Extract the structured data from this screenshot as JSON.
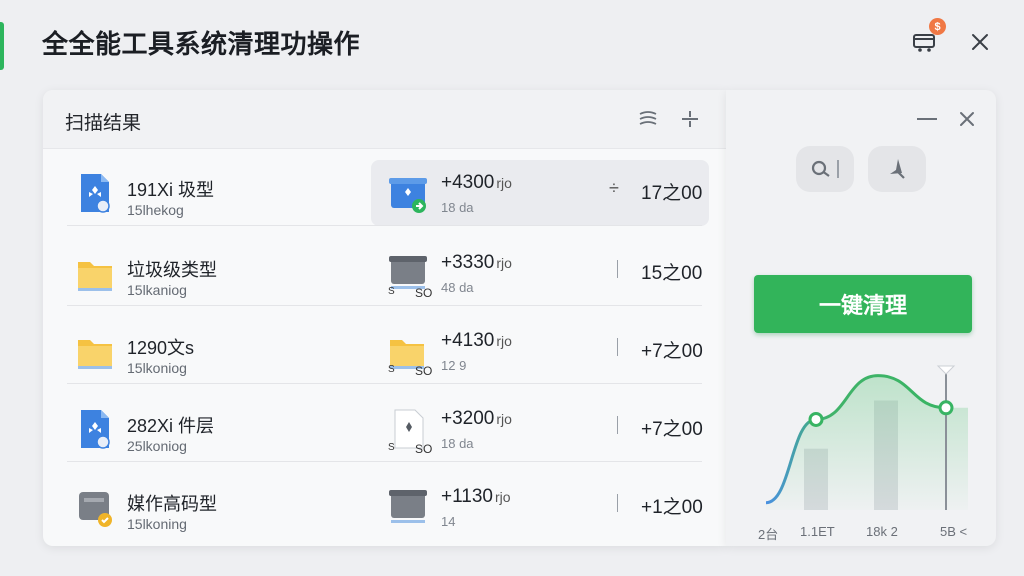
{
  "app": {
    "title": "全全能工具系统清理功操作",
    "cart_badge": "$",
    "accent": "#2db55d"
  },
  "results": {
    "title": "扫描结果",
    "rows": [
      {
        "name": "191Xi 圾型",
        "sub": "15lhekog",
        "count": "+4300",
        "count_unit": "rjo",
        "mid_sub": "18 da",
        "size": "17之00",
        "icon": "blue-file-icon",
        "mid_icon": "blue-box-icon",
        "highlighted": true
      },
      {
        "name": "垃圾级类型",
        "sub": "15lkaniog",
        "count": "+3330",
        "count_unit": "rjo",
        "mid_sub": "48 da",
        "mid_prefix": "S",
        "mid_suffix": "SO",
        "size": "15之00",
        "icon": "yellow-folder-icon",
        "mid_icon": "gray-box-icon",
        "highlighted": false
      },
      {
        "name": "1290文s",
        "sub": "15lkoniog",
        "count": "+4130",
        "count_unit": "rjo",
        "mid_sub": "12 9",
        "mid_prefix": "S",
        "mid_suffix": "SO",
        "size": "+7之00",
        "icon": "yellow-folder-icon",
        "mid_icon": "yellow-folder-icon",
        "highlighted": false
      },
      {
        "name": "282Xi 件层",
        "sub": "25lkoniog",
        "count": "+3200",
        "count_unit": "rjo",
        "mid_sub": "18 da",
        "mid_prefix": "S",
        "mid_suffix": "SO",
        "size": "+7之00",
        "icon": "blue-file-icon",
        "mid_icon": "white-file-icon",
        "highlighted": false
      },
      {
        "name": "媒作高码型",
        "sub": "15lkoning",
        "count": "+1130",
        "count_unit": "rjo",
        "mid_sub": "14",
        "size": "+1之00",
        "icon": "gray-drive-icon",
        "mid_icon": "gray-box-icon",
        "highlighted": false
      }
    ]
  },
  "side": {
    "clean_label": "一键清理",
    "x_labels": [
      "2台",
      "1.1ET",
      "18k 2",
      "5B <"
    ]
  },
  "chart_data": {
    "type": "line",
    "x": [
      "2台",
      "1.1ET",
      "18k 2",
      "5B <"
    ],
    "series": [
      {
        "values": [
          0.05,
          0.62,
          0.92,
          0.7
        ]
      }
    ],
    "bars": [
      0.42,
      0.75
    ]
  }
}
